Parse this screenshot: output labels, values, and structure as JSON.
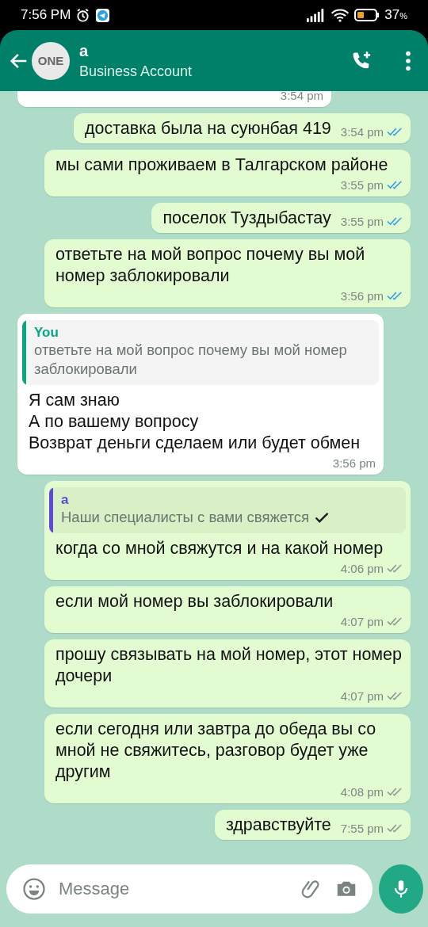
{
  "status_bar": {
    "time": "7:56 PM",
    "battery": "37",
    "battery_unit": "%"
  },
  "header": {
    "avatar_logo": "ONE",
    "name": "a",
    "subtitle": "Business Account"
  },
  "messages": [
    {
      "kind": "in",
      "time": "3:54 pm"
    },
    {
      "kind": "out",
      "text": "доставка была на суюнбая 419",
      "time": "3:54 pm",
      "read": true
    },
    {
      "kind": "out",
      "text": "мы сами проживаем в Талгарском районе",
      "time": "3:55 pm",
      "read": true
    },
    {
      "kind": "out",
      "text": "поселок Туздыбастау",
      "time": "3:55 pm",
      "read": true
    },
    {
      "kind": "out",
      "text": "ответьте на мой вопрос почему вы мой номер заблокировали",
      "time": "3:56 pm",
      "read": true
    },
    {
      "kind": "in",
      "quote": {
        "author": "You",
        "color": "#06a884",
        "text": "ответьте на мой вопрос почему вы мой номер заблокировали",
        "tick": false
      },
      "text": "Я сам знаю\nА по вашему вопросу\nВозврат деньги сделаем или будет обмен",
      "time": "3:56 pm"
    },
    {
      "kind": "out",
      "quote": {
        "author": "a",
        "color": "#5b4bd6",
        "text": "Наши специалисты с вами свяжется",
        "tick": true
      },
      "text": "когда со мной свяжутся и на какой номер",
      "time": "4:06 pm",
      "read": false
    },
    {
      "kind": "out",
      "text": "если мой номер вы заблокировали",
      "time": "4:07 pm",
      "read": false
    },
    {
      "kind": "out",
      "text": "прошу связывать на мой номер, этот номер дочери",
      "time": "4:07 pm",
      "read": false
    },
    {
      "kind": "out",
      "text": "если сегодня или завтра до обеда вы со мной не свяжитесь, разговор будет уже другим",
      "time": "4:08 pm",
      "read": false
    },
    {
      "kind": "out",
      "text": "здравствуйте",
      "time": "7:55 pm",
      "read": false
    }
  ],
  "composer": {
    "placeholder": "Message"
  }
}
